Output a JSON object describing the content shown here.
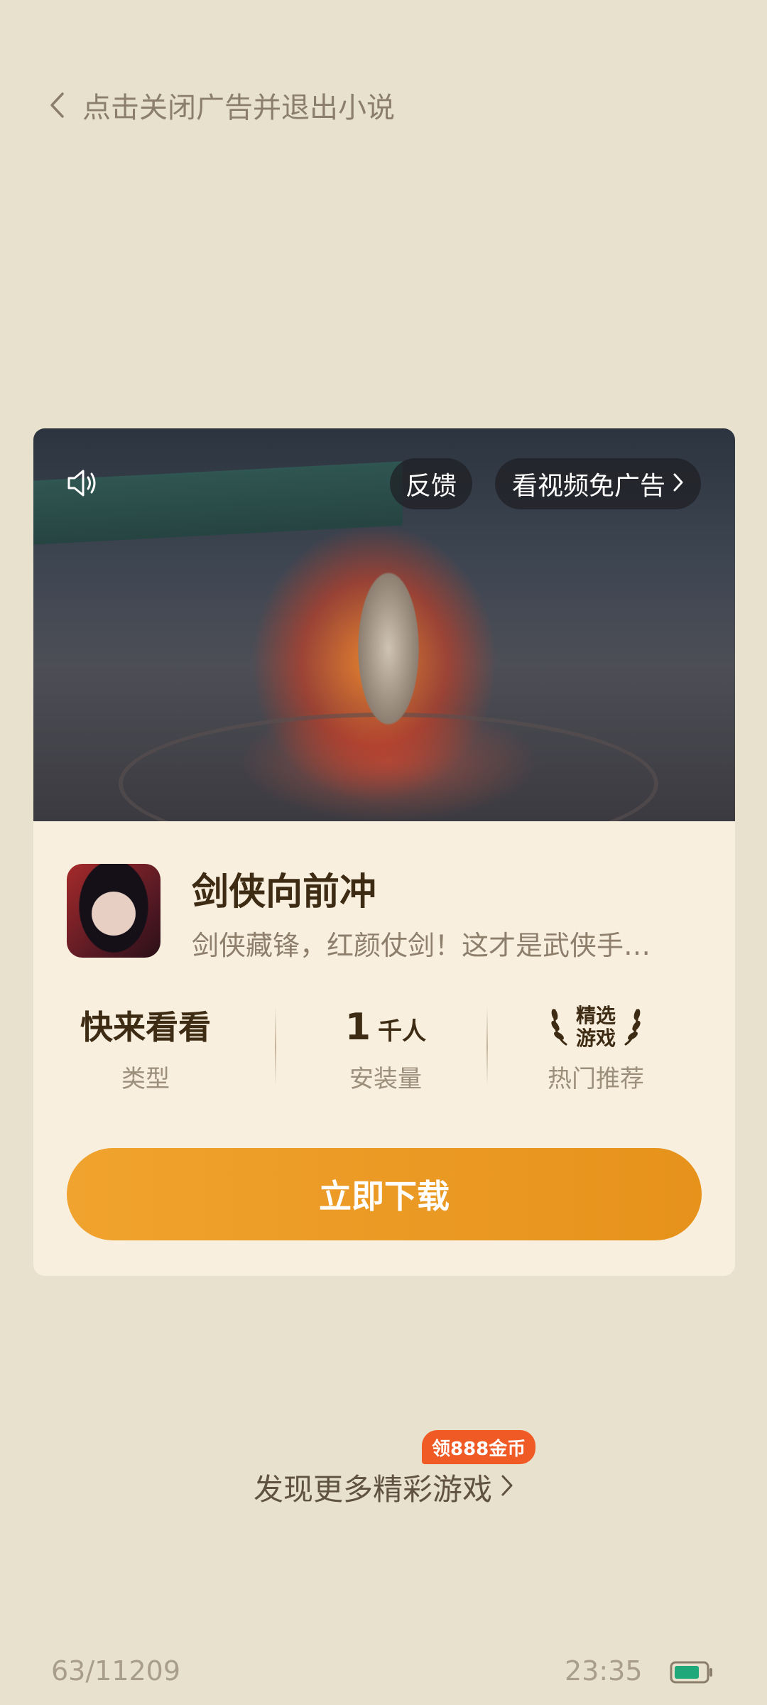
{
  "topbar": {
    "back_icon": "chevron-left-icon",
    "label": "点击关闭广告并退出小说"
  },
  "ad": {
    "video": {
      "mute_icon": "speaker-icon",
      "feedback_label": "反馈",
      "skip_label": "看视频免广告",
      "skip_icon": "chevron-right-icon"
    },
    "app": {
      "name": "剑侠向前冲",
      "description": "剑侠藏锋，红颜仗剑！这才是武侠手…"
    },
    "stats": [
      {
        "value": "快来看看",
        "label": "类型"
      },
      {
        "number": "1",
        "unit": "千人",
        "label": "安装量"
      },
      {
        "badge_line1": "精选",
        "badge_line2": "游戏",
        "label": "热门推荐",
        "badge_icon": "laurel-icon"
      }
    ],
    "download_label": "立即下载"
  },
  "discover": {
    "label": "发现更多精彩游戏",
    "reward_tag": "领888金币",
    "chevron_icon": "chevron-right-icon"
  },
  "footer": {
    "page_progress": "63/11209",
    "time": "23:35",
    "battery_icon": "battery-icon",
    "battery_color": "#1fa87a"
  },
  "colors": {
    "background": "#e8e1cd",
    "card": "#f8efde",
    "accent": "#e99a22",
    "reward": "#f05a25"
  }
}
